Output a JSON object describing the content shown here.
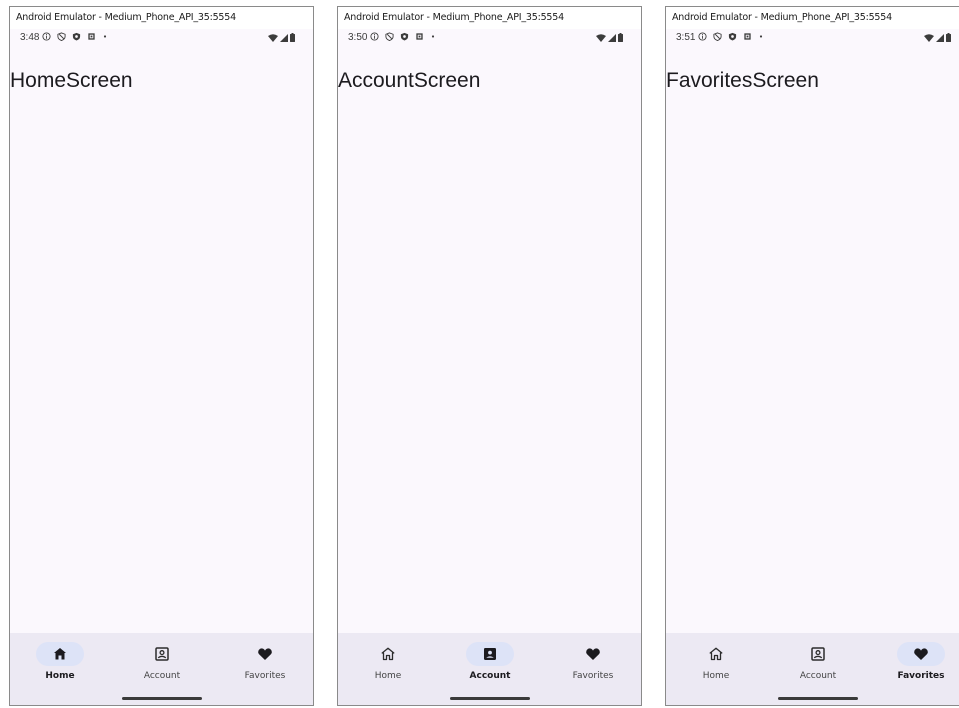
{
  "colors": {
    "screen_bg": "#fbf8fd",
    "nav_bg": "#ece9f3",
    "active_pill": "#dde3f7",
    "text": "#1c1b1f"
  },
  "nav_labels": {
    "home": "Home",
    "account": "Account",
    "favorites": "Favorites"
  },
  "windows": [
    {
      "title": "Android Emulator - Medium_Phone_API_35:5554",
      "time": "3:48",
      "screen_title": "HomeScreen",
      "active_tab": "Home"
    },
    {
      "title": "Android Emulator - Medium_Phone_API_35:5554",
      "time": "3:50",
      "screen_title": "AccountScreen",
      "active_tab": "Account"
    },
    {
      "title": "Android Emulator - Medium_Phone_API_35:5554",
      "time": "3:51",
      "screen_title": "FavoritesScreen",
      "active_tab": "Favorites"
    }
  ],
  "icons": {
    "status_left": [
      "info-icon",
      "shield-icon",
      "security-icon",
      "storage-icon",
      "dot-icon"
    ],
    "status_right": [
      "wifi-icon",
      "signal-icon",
      "battery-icon"
    ],
    "nav_home_active": "home-filled-icon",
    "nav_home_inactive": "home-outline-icon",
    "nav_account_active": "account-box-filled-icon",
    "nav_account_inactive": "account-box-outline-icon",
    "nav_favorites": "heart-icon"
  }
}
